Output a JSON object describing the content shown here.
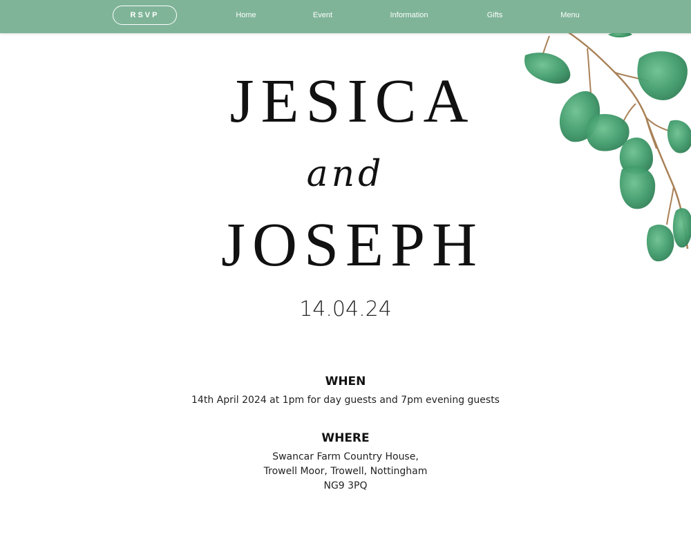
{
  "nav": {
    "rsvp_label": "RSVP",
    "links": [
      "Home",
      "Event",
      "Information",
      "Gifts",
      "Menu"
    ]
  },
  "hero": {
    "name_1": "JESICA",
    "and_word": "and",
    "name_2": "JOSEPH",
    "date": "14.04.24"
  },
  "when": {
    "heading": "WHEN",
    "text": "14th April 2024 at 1pm for day guests and 7pm evening guests"
  },
  "where": {
    "heading": "WHERE",
    "lines": [
      "Swancar Farm Country House,",
      "Trowell Moor, Trowell, Nottingham",
      "NG9 3PQ"
    ]
  },
  "colors": {
    "nav_background": "#7fb498",
    "nav_text": "#ffffff",
    "leaf_green": "#3f9a6a",
    "stem_brown": "#a98157",
    "body_text": "#111111"
  },
  "icons": {
    "decoration": "eucalyptus-leaves-illustration"
  }
}
